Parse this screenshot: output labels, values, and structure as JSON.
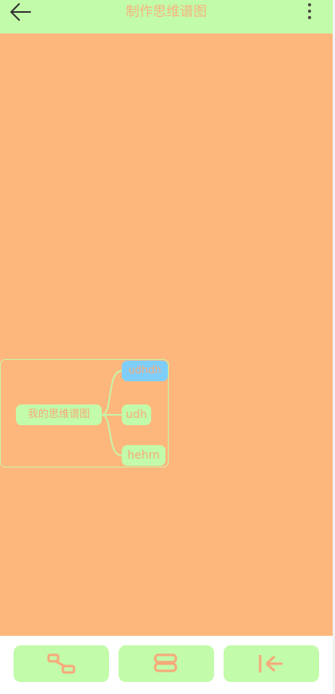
{
  "app": {
    "title": "制作思维谱图",
    "colors": {
      "bar": "#c2fba9",
      "canvas": "#fdb77c",
      "accent": "#f7a97a",
      "selected_node": "#7fcefa"
    }
  },
  "header": {
    "back_icon": "arrow-left-icon",
    "more_icon": "more-vertical-icon"
  },
  "mindmap": {
    "root": "我的思维谱图",
    "children": [
      {
        "label": "udhdh",
        "selected": true
      },
      {
        "label": "udh",
        "selected": false
      },
      {
        "label": "hehrn",
        "selected": false
      }
    ]
  },
  "toolbar": {
    "buttons": [
      {
        "icon": "add-sibling-node-icon"
      },
      {
        "icon": "add-child-node-icon"
      },
      {
        "icon": "collapse-to-left-icon"
      }
    ]
  }
}
